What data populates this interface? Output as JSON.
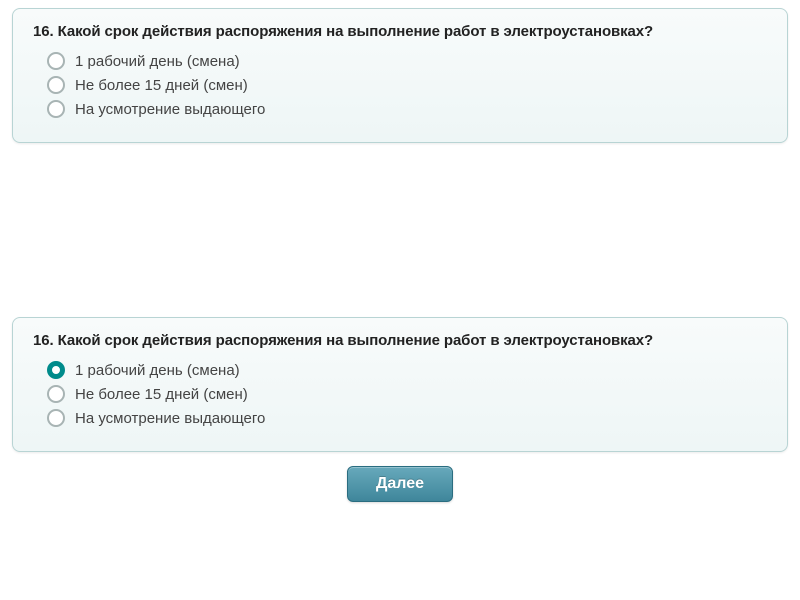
{
  "card1": {
    "question": "16. Какой срок действия распоряжения на выполнение работ в электроустановках?",
    "options": [
      "1 рабочий день (смена)",
      "Не более 15 дней (смен)",
      "На усмотрение выдающего"
    ]
  },
  "card2": {
    "question": "16. Какой срок действия распоряжения на выполнение работ в электроустановках?",
    "options": [
      "1 рабочий день (смена)",
      "Не более 15 дней (смен)",
      "На усмотрение выдающего"
    ],
    "selected_index": 0
  },
  "next_button": "Далее"
}
